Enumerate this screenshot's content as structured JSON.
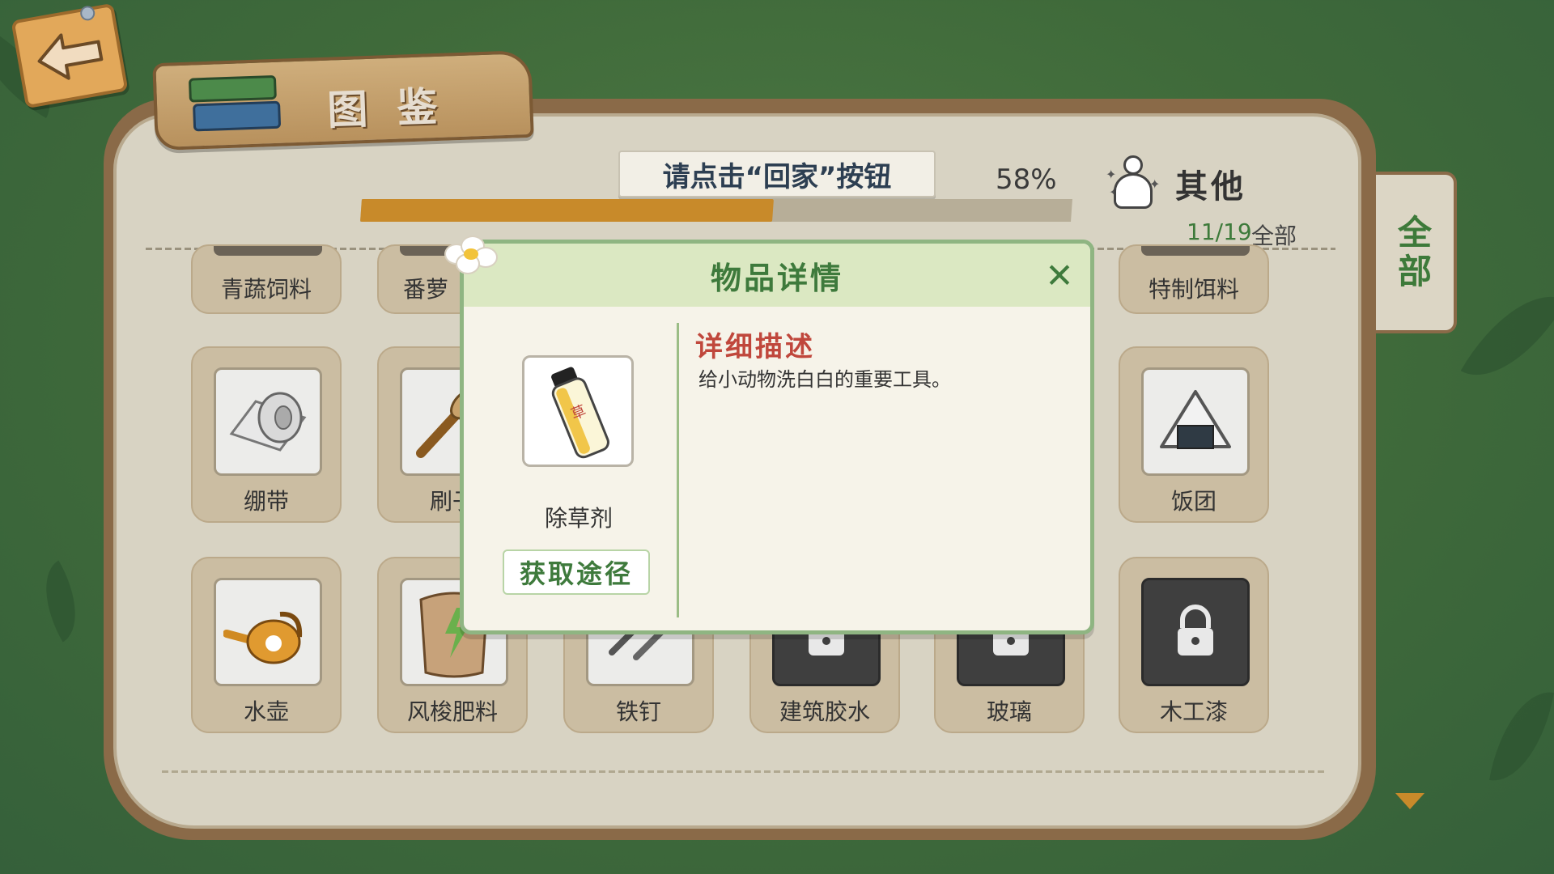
{
  "header": {
    "title": "图鉴",
    "back_icon": "back-arrow-icon"
  },
  "progress": {
    "hint": "请点击“回家”按钮",
    "percent_label": "58%",
    "fraction": 0.58
  },
  "category": {
    "label": "其他",
    "count": "11/19",
    "filter_label": "全部",
    "icon": "teru-teru-bozu-icon"
  },
  "side_tab": {
    "line1": "全",
    "line2": "部"
  },
  "items": [
    {
      "name": "青蔬饲料",
      "state": "partial"
    },
    {
      "name": "番萝",
      "state": "partial-hidden"
    },
    {
      "name": "特制饵料",
      "state": "partial"
    },
    {
      "name": "绷带",
      "icon": "bandage-icon"
    },
    {
      "name": "刷子",
      "icon": "brush-icon"
    },
    {
      "name": "饭团",
      "icon": "rice-ball-icon"
    },
    {
      "name": "水壶",
      "icon": "watering-can-icon"
    },
    {
      "name": "风梭肥料",
      "icon": "fertilizer-bag-icon"
    },
    {
      "name": "铁钉",
      "icon": "nails-icon"
    },
    {
      "name": "建筑胶水",
      "icon": "lock-icon",
      "locked": true
    },
    {
      "name": "玻璃",
      "icon": "lock-icon",
      "locked": true
    },
    {
      "name": "木工漆",
      "icon": "lock-icon",
      "locked": true
    }
  ],
  "modal": {
    "title": "物品详情",
    "item_name": "除草剂",
    "item_icon": "spray-can-icon",
    "item_icon_label": "草",
    "obtain_label": "获取途径",
    "desc_title": "详细描述",
    "desc_text": "给小动物洗白白的重要工具。"
  },
  "colors": {
    "accent_green": "#3e7a3c",
    "progress_orange": "#c88a2a",
    "desc_red": "#c0473c"
  }
}
